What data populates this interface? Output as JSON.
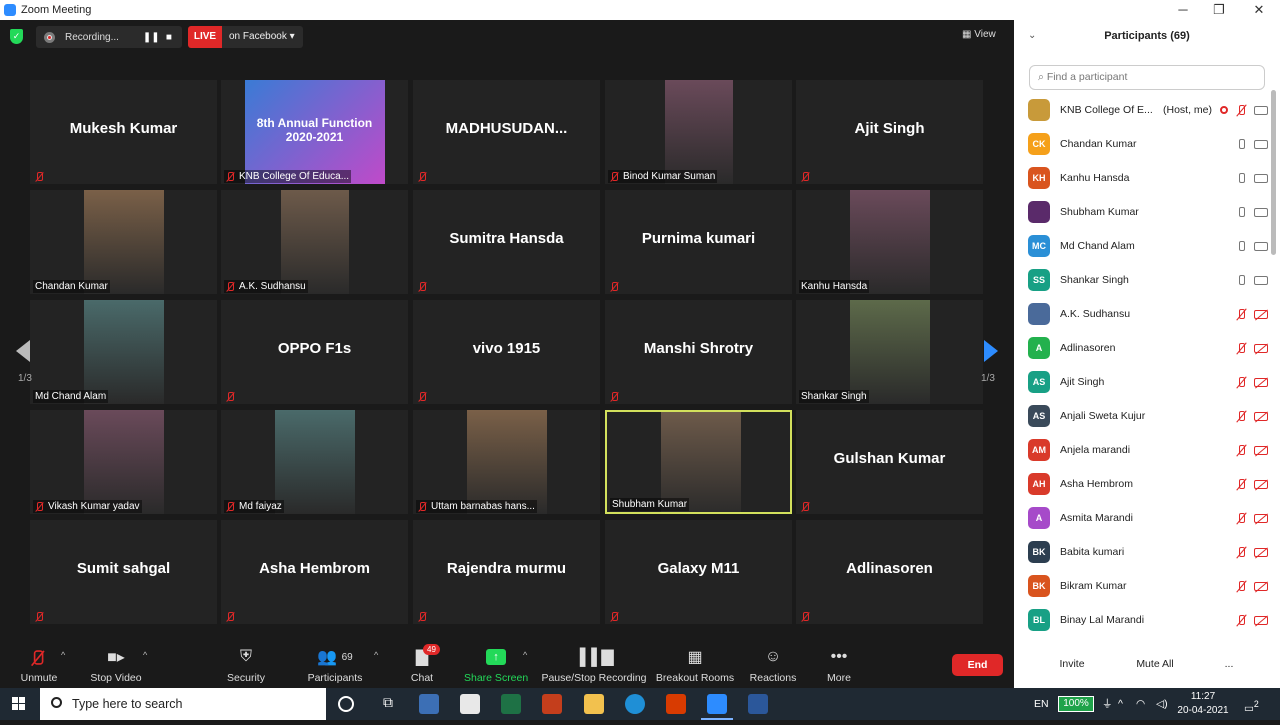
{
  "window": {
    "title": "Zoom Meeting",
    "min": "─",
    "max": "❐",
    "close": "✕"
  },
  "topbar": {
    "recording_label": "Recording...",
    "pause_glyph": "❚❚",
    "stop_glyph": "■",
    "live_label": "LIVE",
    "live_target": "on Facebook ▾",
    "view_label": "View"
  },
  "pager": {
    "page_left": "1/3",
    "page_right": "1/3"
  },
  "tiles": [
    {
      "name": "Mukesh Kumar",
      "label": "",
      "muted": true,
      "video": false
    },
    {
      "name": "",
      "label": "KNB College Of Educa...",
      "muted": true,
      "video": true,
      "poster": "8th Annual Function 2020-2021"
    },
    {
      "name": "MADHUSUDAN...",
      "label": "",
      "muted": true,
      "video": false
    },
    {
      "name": "",
      "label": "Binod Kumar Suman",
      "muted": true,
      "video": true
    },
    {
      "name": "Ajit Singh",
      "label": "",
      "muted": true,
      "video": false
    },
    {
      "name": "",
      "label": "Chandan Kumar",
      "muted": false,
      "video": true
    },
    {
      "name": "",
      "label": "A.K. Sudhansu",
      "muted": true,
      "video": true
    },
    {
      "name": "Sumitra Hansda",
      "label": "",
      "muted": true,
      "video": false
    },
    {
      "name": "Purnima kumari",
      "label": "",
      "muted": true,
      "video": false
    },
    {
      "name": "",
      "label": "Kanhu Hansda",
      "muted": false,
      "video": true
    },
    {
      "name": "",
      "label": "Md Chand Alam",
      "muted": false,
      "video": true
    },
    {
      "name": "OPPO F1s",
      "label": "",
      "muted": true,
      "video": false
    },
    {
      "name": "vivo 1915",
      "label": "",
      "muted": true,
      "video": false
    },
    {
      "name": "Manshi Shrotry",
      "label": "",
      "muted": true,
      "video": false
    },
    {
      "name": "",
      "label": "Shankar Singh",
      "muted": false,
      "video": true
    },
    {
      "name": "",
      "label": "Vikash Kumar yadav",
      "muted": true,
      "video": true
    },
    {
      "name": "",
      "label": "Md faiyaz",
      "muted": true,
      "video": true
    },
    {
      "name": "",
      "label": "Uttam barnabas hans...",
      "muted": true,
      "video": true
    },
    {
      "name": "",
      "label": "Shubham Kumar",
      "muted": false,
      "video": true,
      "active": true
    },
    {
      "name": "Gulshan Kumar",
      "label": "",
      "muted": true,
      "video": false
    },
    {
      "name": "Sumit sahgal",
      "label": "",
      "muted": true,
      "video": false
    },
    {
      "name": "Asha Hembrom",
      "label": "",
      "muted": true,
      "video": false
    },
    {
      "name": "Rajendra murmu",
      "label": "",
      "muted": true,
      "video": false
    },
    {
      "name": "Galaxy M11",
      "label": "",
      "muted": true,
      "video": false
    },
    {
      "name": "Adlinasoren",
      "label": "",
      "muted": true,
      "video": false
    }
  ],
  "toolbar": {
    "unmute": "Unmute",
    "stop_video": "Stop Video",
    "security": "Security",
    "participants": "Participants",
    "participants_count": "69",
    "chat": "Chat",
    "chat_badge": "49",
    "share_screen": "Share Screen",
    "pause_stop_recording": "Pause/Stop Recording",
    "breakout_rooms": "Breakout Rooms",
    "reactions": "Reactions",
    "more": "More",
    "end": "End"
  },
  "panel": {
    "title": "Participants (69)",
    "search_placeholder": "Find a participant",
    "invite": "Invite",
    "mute_all": "Mute All",
    "more": "...",
    "participants": [
      {
        "initials": "",
        "name": "KNB College Of E...",
        "host": "(Host, me)",
        "color": "#c89a3a",
        "mic": "off",
        "cam": "on",
        "image": true
      },
      {
        "initials": "CK",
        "name": "Chandan Kumar",
        "host": "",
        "color": "#f5a01a",
        "mic": "on",
        "cam": "on"
      },
      {
        "initials": "KH",
        "name": "Kanhu Hansda",
        "host": "",
        "color": "#d9541e",
        "mic": "on",
        "cam": "on"
      },
      {
        "initials": "",
        "name": "Shubham Kumar",
        "host": "",
        "color": "#5a2a6a",
        "mic": "on",
        "cam": "on",
        "image": true
      },
      {
        "initials": "MC",
        "name": "Md Chand Alam",
        "host": "",
        "color": "#2a8fd6",
        "mic": "on",
        "cam": "on"
      },
      {
        "initials": "SS",
        "name": "Shankar Singh",
        "host": "",
        "color": "#18a085",
        "mic": "on",
        "cam": "on"
      },
      {
        "initials": "",
        "name": "A.K. Sudhansu",
        "host": "",
        "color": "#4a6a9a",
        "mic": "off",
        "cam": "off",
        "image": true
      },
      {
        "initials": "A",
        "name": "Adlinasoren",
        "host": "",
        "color": "#23b14d",
        "mic": "off",
        "cam": "off"
      },
      {
        "initials": "AS",
        "name": "Ajit Singh",
        "host": "",
        "color": "#18a085",
        "mic": "off",
        "cam": "off"
      },
      {
        "initials": "AS",
        "name": "Anjali Sweta Kujur",
        "host": "",
        "color": "#3a4a5a",
        "mic": "off",
        "cam": "off"
      },
      {
        "initials": "AM",
        "name": "Anjela marandi",
        "host": "",
        "color": "#d93a2a",
        "mic": "off",
        "cam": "off"
      },
      {
        "initials": "AH",
        "name": "Asha Hembrom",
        "host": "",
        "color": "#d93a2a",
        "mic": "off",
        "cam": "off"
      },
      {
        "initials": "A",
        "name": "Asmita Marandi",
        "host": "",
        "color": "#a64ac9",
        "mic": "off",
        "cam": "off"
      },
      {
        "initials": "BK",
        "name": "Babita kumari",
        "host": "",
        "color": "#2c3e50",
        "mic": "off",
        "cam": "off"
      },
      {
        "initials": "BK",
        "name": "Bikram Kumar",
        "host": "",
        "color": "#d9541e",
        "mic": "off",
        "cam": "off"
      },
      {
        "initials": "BL",
        "name": "Binay Lal Marandi",
        "host": "",
        "color": "#18a085",
        "mic": "off",
        "cam": "off"
      }
    ]
  },
  "taskbar": {
    "search_placeholder": "Type here to search",
    "lang": "EN",
    "battery": "100%",
    "time": "11:27",
    "date": "20-04-2021",
    "notifications": "2"
  }
}
